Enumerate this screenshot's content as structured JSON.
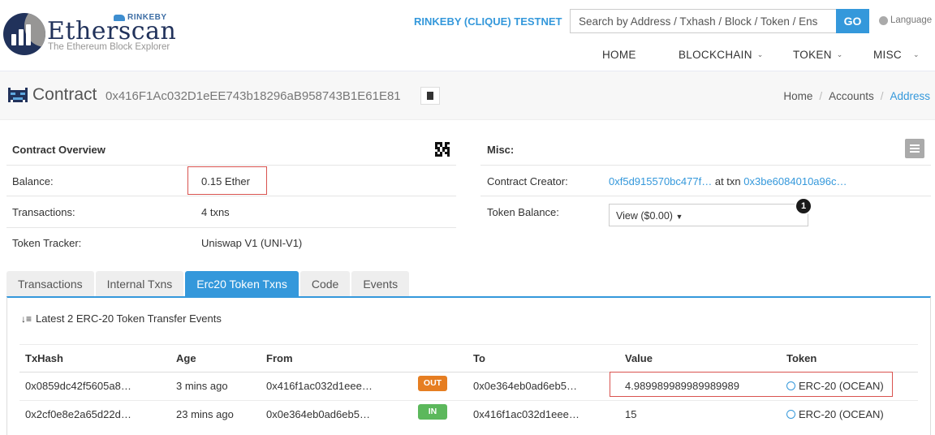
{
  "header": {
    "logo_word": "Etherscan",
    "logo_tagline": "The Ethereum Block Explorer",
    "logo_network": "RINKEBY",
    "network_label": "RINKEBY (CLIQUE) TESTNET",
    "search_placeholder": "Search by Address / Txhash / Block / Token / Ens",
    "go_label": "GO",
    "language_label": "Language",
    "nav": [
      {
        "label": "HOME",
        "has_dropdown": false
      },
      {
        "label": "BLOCKCHAIN",
        "has_dropdown": true
      },
      {
        "label": "TOKEN",
        "has_dropdown": true
      },
      {
        "label": "MISC",
        "has_dropdown": true
      }
    ]
  },
  "page": {
    "title": "Contract",
    "address": "0x416F1Ac032D1eEE743b18296aB958743B1E61E81",
    "breadcrumb": [
      "Home",
      "Accounts",
      "Address"
    ]
  },
  "overview": {
    "title": "Contract Overview",
    "rows": [
      {
        "label": "Balance:",
        "value": "0.15 Ether"
      },
      {
        "label": "Transactions:",
        "value": "4 txns"
      },
      {
        "label": "Token Tracker:",
        "value": "Uniswap V1 (UNI-V1)"
      }
    ]
  },
  "misc": {
    "title": "Misc:",
    "creator_label": "Contract Creator:",
    "creator_address": "0xf5d915570bc477f…",
    "creator_at_txn": "at txn",
    "creator_txn": "0x3be6084010a96c…",
    "token_balance_label": "Token Balance:",
    "token_balance_value": "View ($0.00)",
    "badge_count": "1"
  },
  "tabs": [
    {
      "label": "Transactions",
      "active": false
    },
    {
      "label": "Internal Txns",
      "active": false
    },
    {
      "label": "Erc20 Token Txns",
      "active": true
    },
    {
      "label": "Code",
      "active": false
    },
    {
      "label": "Events",
      "active": false
    }
  ],
  "token_txns": {
    "summary": "Latest 2 ERC-20 Token Transfer Events",
    "columns": [
      "TxHash",
      "Age",
      "From",
      "To",
      "Value",
      "Token"
    ],
    "rows": [
      {
        "txhash": "0x0859dc42f5605a8…",
        "age": "3 mins ago",
        "from": "0x416f1ac032d1eee…",
        "direction": "OUT",
        "to": "0x0e364eb0ad6eb5…",
        "value": "4.989989989989989989",
        "token": "ERC-20 (OCEAN)"
      },
      {
        "txhash": "0x2cf0e8e2a65d22d…",
        "age": "23 mins ago",
        "from": "0x0e364eb0ad6eb5…",
        "direction": "IN",
        "to": "0x416f1ac032d1eee…",
        "value": "15",
        "token": "ERC-20 (OCEAN)"
      }
    ]
  },
  "colors": {
    "accent": "#3498db",
    "brand": "#21325b",
    "out_badge": "#e67e22",
    "in_badge": "#5cb85c",
    "highlight_box": "#d9534f"
  }
}
